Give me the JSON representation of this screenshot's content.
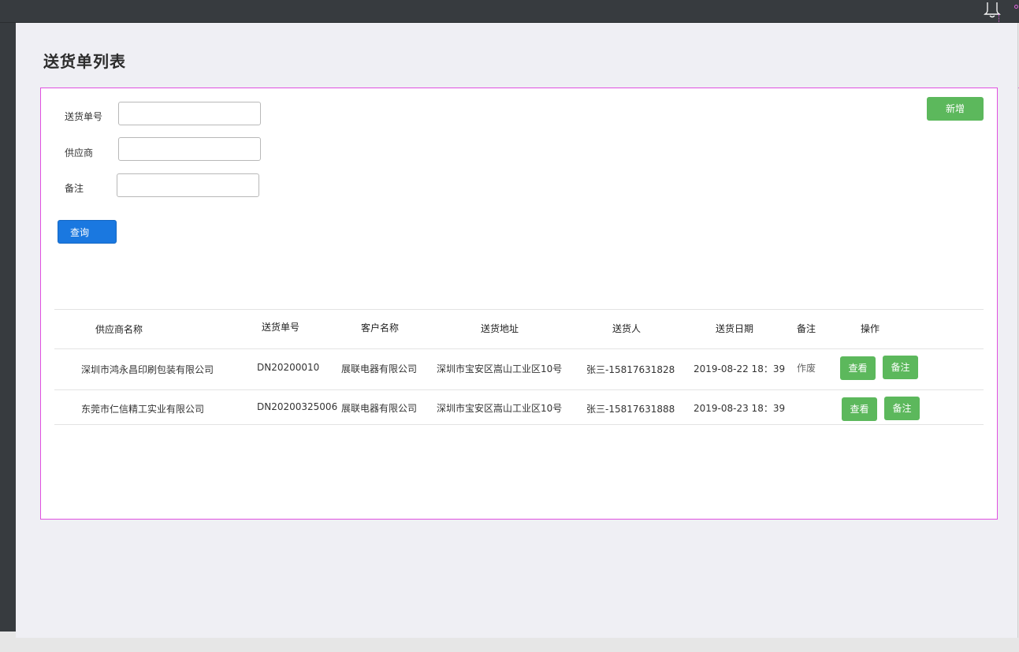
{
  "page": {
    "title": "送货单列表"
  },
  "form": {
    "fields": [
      {
        "label": "送货单号",
        "value": ""
      },
      {
        "label": "供应商",
        "value": ""
      },
      {
        "label": "备注",
        "value": ""
      }
    ],
    "query_label": "查询",
    "add_label": "新增"
  },
  "table": {
    "headers": [
      "供应商名称",
      "送货单号",
      "客户名称",
      "送货地址",
      "送货人",
      "送货日期",
      "备注",
      "操作"
    ],
    "rows": [
      {
        "supplier": "深圳市鸿永昌印刷包装有限公司",
        "order_no": "DN20200010",
        "customer": "展联电器有限公司",
        "address": "深圳市宝安区嵩山工业区10号",
        "deliverer": "张三-15817631828",
        "date": "2019-08-22 18：39",
        "remark": "作废",
        "view_label": "查看",
        "note_label": "备注"
      },
      {
        "supplier": "东莞市仁信精工实业有限公司",
        "order_no": "DN20200325006",
        "customer": "展联电器有限公司",
        "address": "深圳市宝安区嵩山工业区10号",
        "deliverer": "张三-15817631888",
        "date": "2019-08-23 18：39",
        "remark": "",
        "view_label": "查看",
        "note_label": "备注"
      }
    ]
  },
  "icons": {
    "bell": "bell-icon"
  },
  "colors": {
    "topbar": "#373b3f",
    "primary": "#1a78e0",
    "success": "#5cb85c",
    "selection_outline": "#e050e0"
  }
}
